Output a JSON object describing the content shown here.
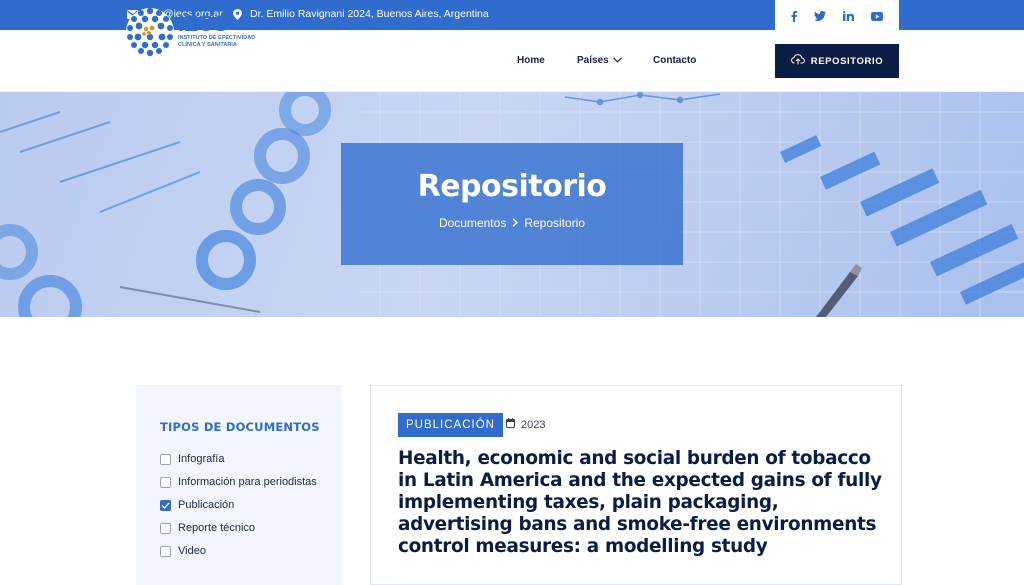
{
  "topbar": {
    "email": "info@iecs.org.ar",
    "address": "Dr. Emilio Ravignani 2024, Buenos Aires, Argentina",
    "social": [
      "facebook-icon",
      "twitter-icon",
      "linkedin-icon",
      "youtube-icon"
    ]
  },
  "header": {
    "logo": {
      "name": "IECS",
      "subtitle_line1": "INSTITUTO DE EFECTIVIDAD",
      "subtitle_line2": "CLÍNICA Y SANITARIA"
    },
    "nav": {
      "home": "Home",
      "paises": "Países",
      "contacto": "Contacto"
    },
    "repo_button": "REPOSITORIO"
  },
  "hero": {
    "title": "Repositorio",
    "breadcrumb": [
      "Documentos",
      "Repositorio"
    ]
  },
  "sidebar": {
    "heading": "TIPOS DE DOCUMENTOS",
    "filters": [
      {
        "label": "Infografía",
        "checked": false
      },
      {
        "label": "Información para periodistas",
        "checked": false
      },
      {
        "label": "Publicación",
        "checked": true
      },
      {
        "label": "Reporte técnico",
        "checked": false
      },
      {
        "label": "Video",
        "checked": false
      }
    ]
  },
  "result": {
    "type_badge": "PUBLICACIÓN",
    "year": "2023",
    "title": "Health, economic and social burden of tobacco in Latin America and the expected gains of fully implementing taxes, plain packaging, advertising bans and smoke-free environments control measures: a modelling study"
  },
  "colors": {
    "primary": "#2f6ccd",
    "navy": "#0b1c45",
    "sidebar_bg": "#f2f5fb"
  }
}
